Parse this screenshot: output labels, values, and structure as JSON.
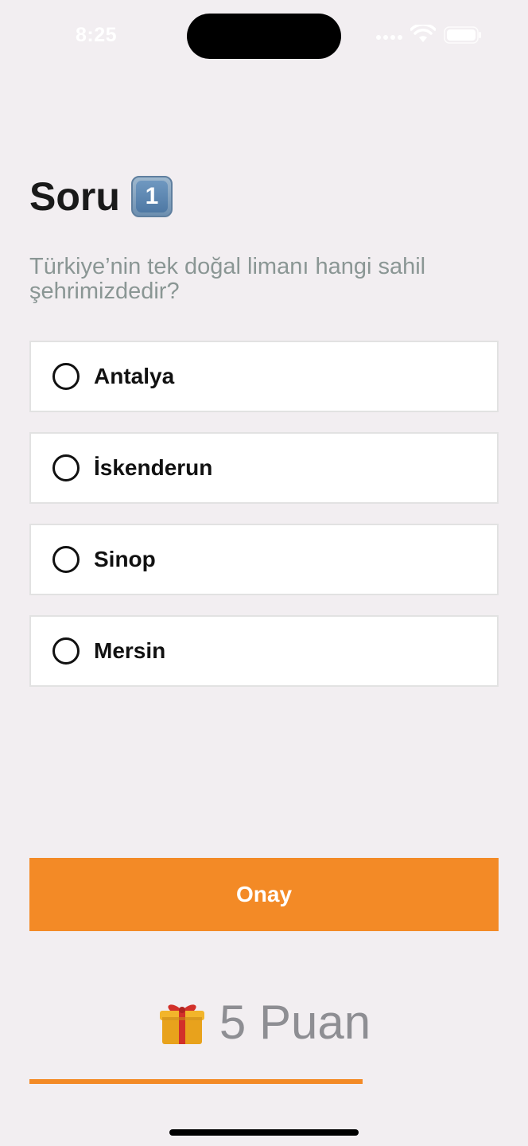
{
  "status_bar": {
    "time": "8:25",
    "icons": [
      "signal-icon",
      "wifi-icon",
      "battery-icon"
    ]
  },
  "header": {
    "title": "Soru",
    "question_number": "1",
    "number_icon": "keycap-1-icon"
  },
  "question": {
    "text": "Türkiye’nin tek doğal limanı hangi sahil şehrimizdedir?"
  },
  "options": [
    {
      "label": "Antalya",
      "selected": false
    },
    {
      "label": "İskenderun",
      "selected": false
    },
    {
      "label": "Sinop",
      "selected": false
    },
    {
      "label": "Mersin",
      "selected": false
    }
  ],
  "confirm_button": {
    "label": "Onay"
  },
  "points": {
    "icon": "gift-icon",
    "text": "5 Puan"
  },
  "progress": {
    "fraction": 0.71
  },
  "colors": {
    "accent": "#F38A26",
    "background": "#F2EEF1",
    "question_text": "#8A9694",
    "points_text": "#8E8E93"
  }
}
